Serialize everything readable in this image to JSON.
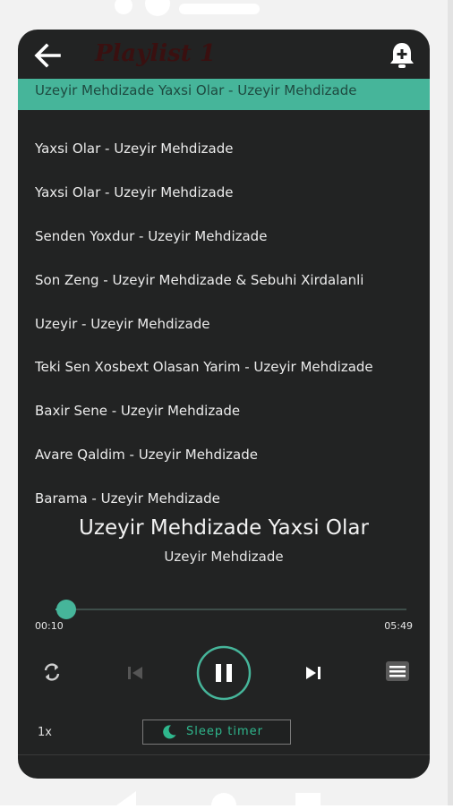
{
  "header": {
    "title": "Playlist 1"
  },
  "playlist": {
    "items": [
      {
        "label": "Uzeyir Mehdizade Yaxsi Olar - Uzeyir Mehdizade",
        "active": true
      },
      {
        "label": "Yaxsi Olar - Uzeyir Mehdizade"
      },
      {
        "label": "Yaxsi Olar - Uzeyir Mehdizade"
      },
      {
        "label": "Senden Yoxdur - Uzeyir Mehdizade"
      },
      {
        "label": "Son Zeng - Uzeyir Mehdizade & Sebuhi Xirdalanli"
      },
      {
        "label": "Uzeyir - Uzeyir Mehdizade"
      },
      {
        "label": "Teki Sen Xosbext Olasan Yarim - Uzeyir Mehdizade"
      },
      {
        "label": "Baxir Sene - Uzeyir Mehdizade"
      },
      {
        "label": "Avare Qaldim - Uzeyir Mehdizade"
      },
      {
        "label": "Barama - Uzeyir Mehdizade"
      }
    ]
  },
  "now_playing": {
    "title": "Uzeyir Mehdizade Yaxsi Olar",
    "artist": "Uzeyir Mehdizade",
    "elapsed": "00:10",
    "duration": "05:49",
    "progress_fraction": 0.03
  },
  "controls": {
    "speed": "1x",
    "sleep_timer": "Sleep timer",
    "icons": [
      "arrow-left-icon",
      "alarm-add-icon",
      "repeat-icon",
      "skip-previous-icon",
      "pause-icon",
      "skip-next-icon",
      "queue-list-icon",
      "moon-icon"
    ]
  },
  "colors": {
    "accent": "#46b59a",
    "background": "#222323",
    "text": "#ececec"
  }
}
